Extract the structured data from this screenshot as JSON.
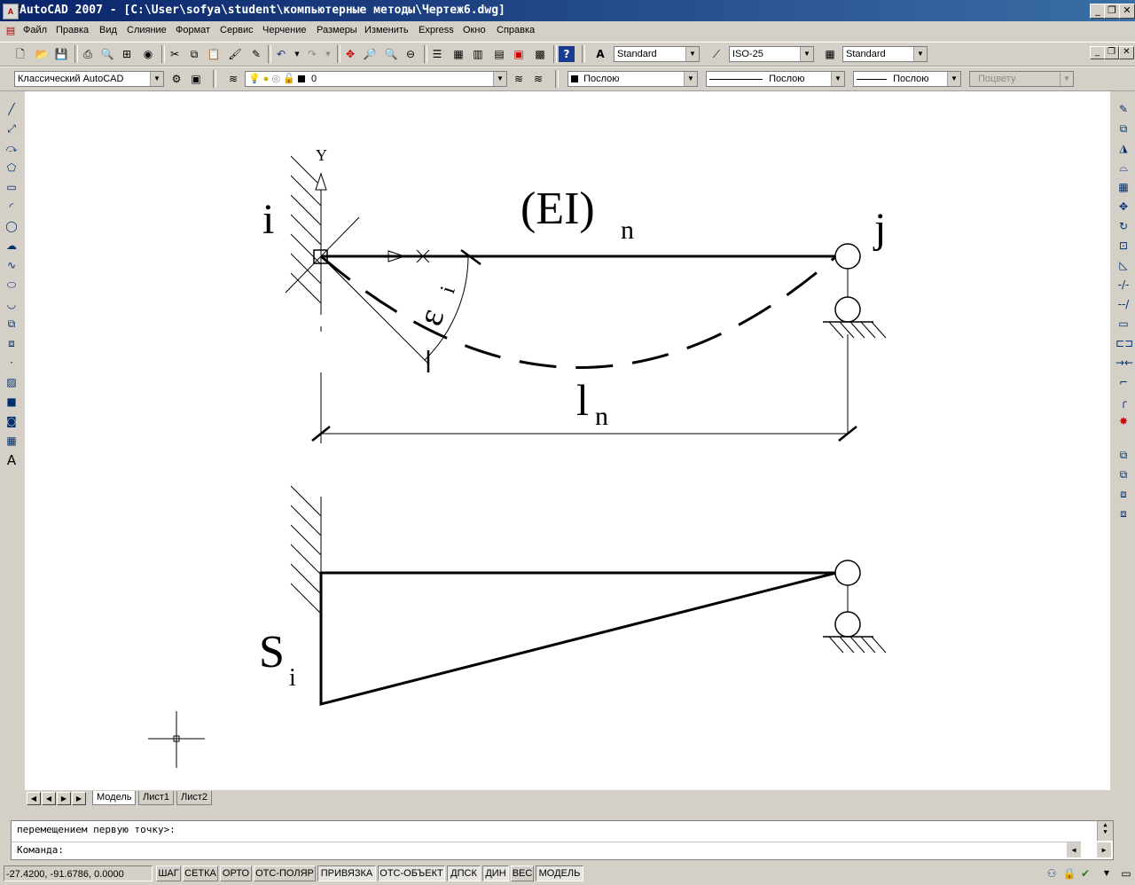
{
  "window": {
    "title": "AutoCAD 2007 - [C:\\User\\sofya\\student\\компьютерные методы\\Чертеж6.dwg]",
    "app_icon": "autocad-logo"
  },
  "menu": {
    "items": [
      "Файл",
      "Правка",
      "Вид",
      "Слияние",
      "Формат",
      "Сервис",
      "Черчение",
      "Размеры",
      "Изменить",
      "Express",
      "Окно",
      "Справка"
    ]
  },
  "styles_toolbar": {
    "text_style": "Standard",
    "dim_style": "ISO-25",
    "table_style": "Standard"
  },
  "workspace": {
    "name": "Классический AutoCAD"
  },
  "layers": {
    "current": "0",
    "color": "Послою",
    "linetype": "Послою",
    "lineweight": "Послою",
    "plotstyle": "Поцвету"
  },
  "drawing": {
    "top": {
      "node_i": "i",
      "node_j": "j",
      "rigidity": "(EI)",
      "rigidity_sub": "n",
      "length": "l",
      "length_sub": "n",
      "angle": "ε",
      "angle_sub": "i",
      "axis_y": "Y"
    },
    "bottom": {
      "moment": "S",
      "moment_sub": "i"
    }
  },
  "layout_tabs": [
    "Модель",
    "Лист1",
    "Лист2"
  ],
  "command_line": {
    "history": "перемещением первую точку>:",
    "prompt": "Команда:"
  },
  "status": {
    "coordinates": "-27.4200, -91.6786, 0.0000",
    "toggles": [
      {
        "label": "ШАГ",
        "on": false
      },
      {
        "label": "СЕТКА",
        "on": false
      },
      {
        "label": "ОРТО",
        "on": false
      },
      {
        "label": "ОТС-ПОЛЯР",
        "on": false
      },
      {
        "label": "ПРИВЯЗКА",
        "on": true
      },
      {
        "label": "ОТС-ОБЪЕКТ",
        "on": true
      },
      {
        "label": "ДПСК",
        "on": true
      },
      {
        "label": "ДИН",
        "on": true
      },
      {
        "label": "ВЕС",
        "on": false
      },
      {
        "label": "МОДЕЛЬ",
        "on": true
      }
    ]
  }
}
